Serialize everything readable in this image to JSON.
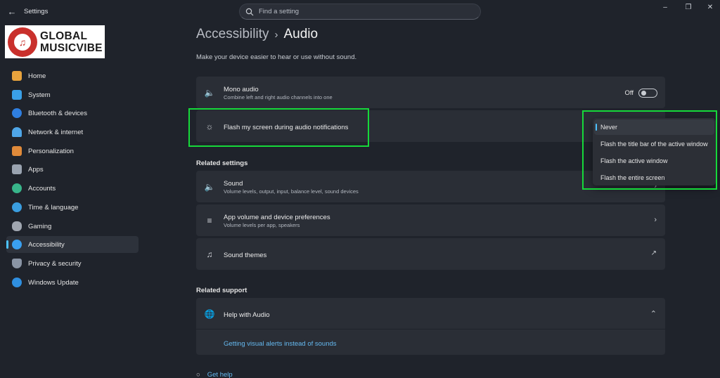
{
  "window": {
    "title": "Settings",
    "back_icon": "back-arrow-icon",
    "controls": [
      "minimize",
      "maximize",
      "close"
    ]
  },
  "search": {
    "placeholder": "Find a setting"
  },
  "logo": {
    "line1": "GLOBAL",
    "line2": "MUSICVIBE"
  },
  "sidebar": {
    "items": [
      {
        "label": "Home",
        "icon": "home-icon",
        "color": "#e8a33d"
      },
      {
        "label": "System",
        "icon": "system-icon",
        "color": "#3aa0e8"
      },
      {
        "label": "Bluetooth & devices",
        "icon": "bluetooth-icon",
        "color": "#2f7fe0"
      },
      {
        "label": "Network & internet",
        "icon": "wifi-icon",
        "color": "#4fa6e8"
      },
      {
        "label": "Personalization",
        "icon": "brush-icon",
        "color": "#e08a3a"
      },
      {
        "label": "Apps",
        "icon": "apps-icon",
        "color": "#9aa3b0"
      },
      {
        "label": "Accounts",
        "icon": "accounts-icon",
        "color": "#38b58a"
      },
      {
        "label": "Time & language",
        "icon": "globe-clock-icon",
        "color": "#3a9ee0"
      },
      {
        "label": "Gaming",
        "icon": "gamepad-icon",
        "color": "#a0a6b0"
      },
      {
        "label": "Accessibility",
        "icon": "accessibility-icon",
        "color": "#3aa0f0",
        "active": true
      },
      {
        "label": "Privacy & security",
        "icon": "shield-icon",
        "color": "#8a95a5"
      },
      {
        "label": "Windows Update",
        "icon": "update-icon",
        "color": "#2f8fe0"
      }
    ]
  },
  "breadcrumb": {
    "parent": "Accessibility",
    "separator": "›",
    "current": "Audio"
  },
  "subtitle": "Make your device easier to hear or use without sound.",
  "mono_audio": {
    "title": "Mono audio",
    "subtitle": "Combine left and right audio channels into one",
    "toggle_label": "Off",
    "toggle_on": false
  },
  "flash": {
    "title": "Flash my screen during audio notifications"
  },
  "dropdown": {
    "options": [
      "Never",
      "Flash the title bar of the active window",
      "Flash the active window",
      "Flash the entire screen"
    ],
    "selected": "Never"
  },
  "related_settings": {
    "heading": "Related settings",
    "items": [
      {
        "title": "Sound",
        "subtitle": "Volume levels, output, input, balance level, sound devices",
        "icon": "speaker-icon"
      },
      {
        "title": "App volume and device preferences",
        "subtitle": "Volume levels per app, speakers",
        "icon": "mixer-icon"
      },
      {
        "title": "Sound themes",
        "subtitle": "",
        "icon": "sound-theme-icon"
      }
    ]
  },
  "related_support": {
    "heading": "Related support",
    "help_title": "Help with Audio",
    "link": "Getting visual alerts instead of sounds"
  },
  "get_help": "Get help"
}
